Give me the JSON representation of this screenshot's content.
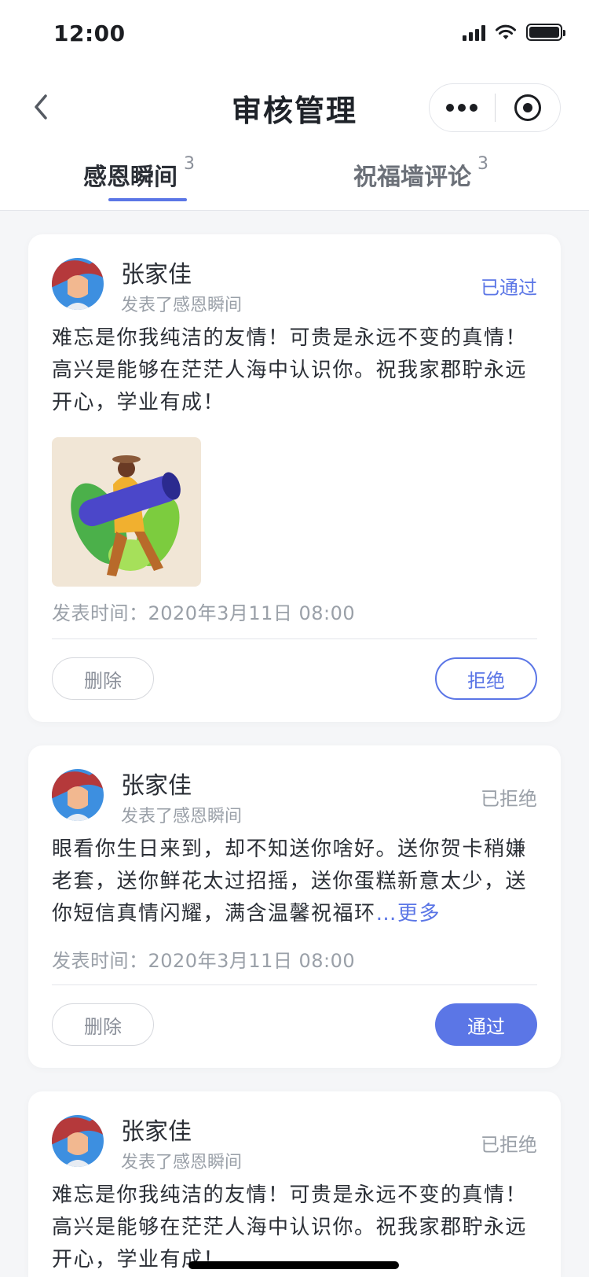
{
  "status_bar": {
    "time": "12:00"
  },
  "nav": {
    "title": "审核管理"
  },
  "tabs": [
    {
      "label": "感恩瞬间",
      "count": "3"
    },
    {
      "label": "祝福墙评论",
      "count": "3"
    }
  ],
  "cards": [
    {
      "user_name": "张家佳",
      "user_sub": "发表了感恩瞬间",
      "status": "已通过",
      "content": "难忘是你我纯洁的友情！可贵是永远不变的真情！高兴是能够在茫茫人海中认识你。祝我家郡聍永远开心，学业有成！",
      "time": "发表时间：2020年3月11日 08:00",
      "delete_label": "删除",
      "action_label": "拒绝"
    },
    {
      "user_name": "张家佳",
      "user_sub": "发表了感恩瞬间",
      "status": "已拒绝",
      "content": "眼看你生日来到，却不知送你啥好。送你贺卡稍嫌老套，送你鲜花太过招摇，送你蛋糕新意太少，送你短信真情闪耀，满含温馨祝福环",
      "more": "…更多",
      "time": "发表时间：2020年3月11日 08:00",
      "delete_label": "删除",
      "action_label": "通过"
    },
    {
      "user_name": "张家佳",
      "user_sub": "发表了感恩瞬间",
      "status": "已拒绝",
      "content": "难忘是你我纯洁的友情！可贵是永远不变的真情！高兴是能够在茫茫人海中认识你。祝我家郡聍永远开心，学业有成！"
    }
  ]
}
